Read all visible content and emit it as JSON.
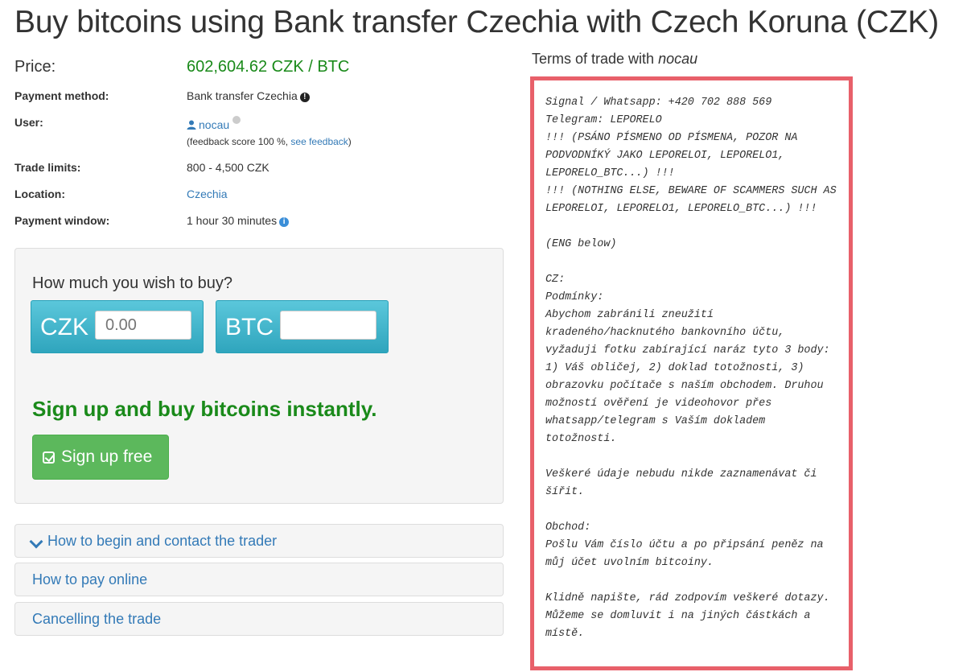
{
  "page": {
    "title": "Buy bitcoins using Bank transfer Czechia with Czech Koruna (CZK)"
  },
  "details": {
    "price_label": "Price:",
    "price_value": "602,604.62 CZK / BTC",
    "payment_method_label": "Payment method:",
    "payment_method_value": "Bank transfer Czechia",
    "user_label": "User:",
    "user_name": "nocau",
    "feedback_prefix": "(feedback score 100 %, ",
    "feedback_link": "see feedback",
    "feedback_suffix": ")",
    "trade_limits_label": "Trade limits:",
    "trade_limits_value": "800 - 4,500 CZK",
    "location_label": "Location:",
    "location_value": "Czechia",
    "payment_window_label": "Payment window:",
    "payment_window_value": "1 hour 30 minutes"
  },
  "buy_box": {
    "question": "How much you wish to buy?",
    "fiat_currency": "CZK",
    "fiat_placeholder": "0.00",
    "crypto_currency": "BTC",
    "crypto_value": "",
    "signup_text": "Sign up and buy bitcoins instantly.",
    "signup_button": "Sign up free"
  },
  "accordion": [
    {
      "label": "How to begin and contact the trader",
      "expanded_indicator": true
    },
    {
      "label": "How to pay online"
    },
    {
      "label": "Cancelling the trade"
    }
  ],
  "terms": {
    "heading_prefix": "Terms of trade with ",
    "heading_user": "nocau",
    "text": "Signal / Whatsapp: +420 702 888 569\nTelegram: LEPORELO\n!!! (PSÁNO PÍSMENO OD PÍSMENA, POZOR NA PODVODNÍKÝ JAKO LEPORELOI, LEPORELO1, LEPORELO_BTC...) !!!\n!!! (NOTHING ELSE, BEWARE OF SCAMMERS SUCH AS LEPORELOI, LEPORELO1, LEPORELO_BTC...) !!!\n\n(ENG below)\n\nCZ:\nPodmínky:\nAbychom zabránili zneužití kradeného/hacknutého bankovního účtu, vyžaduji fotku zabírající naráz tyto 3 body: 1) Váš obličej, 2) doklad totožnosti, 3) obrazovku počítače s naším obchodem. Druhou možností ověření je videohovor přes whatsapp/telegram s Vaším dokladem totožnosti.\n\nVeškeré údaje nebudu nikde zaznamenávat či šířit.\n\nObchod:\nPošlu Vám číslo účtu a po připsání peněz na můj účet uvolním bitcoiny.\n\nKlidně napište, rád zodpovím veškeré dotazy. Můžeme se domluvit i na jiných částkách a místě."
  },
  "colors": {
    "price_green": "#1a8a1a",
    "link_blue": "#337ab7",
    "terms_border": "#e8606a",
    "currency_box": "#3fb4cc",
    "signup_button": "#5cb85c"
  }
}
